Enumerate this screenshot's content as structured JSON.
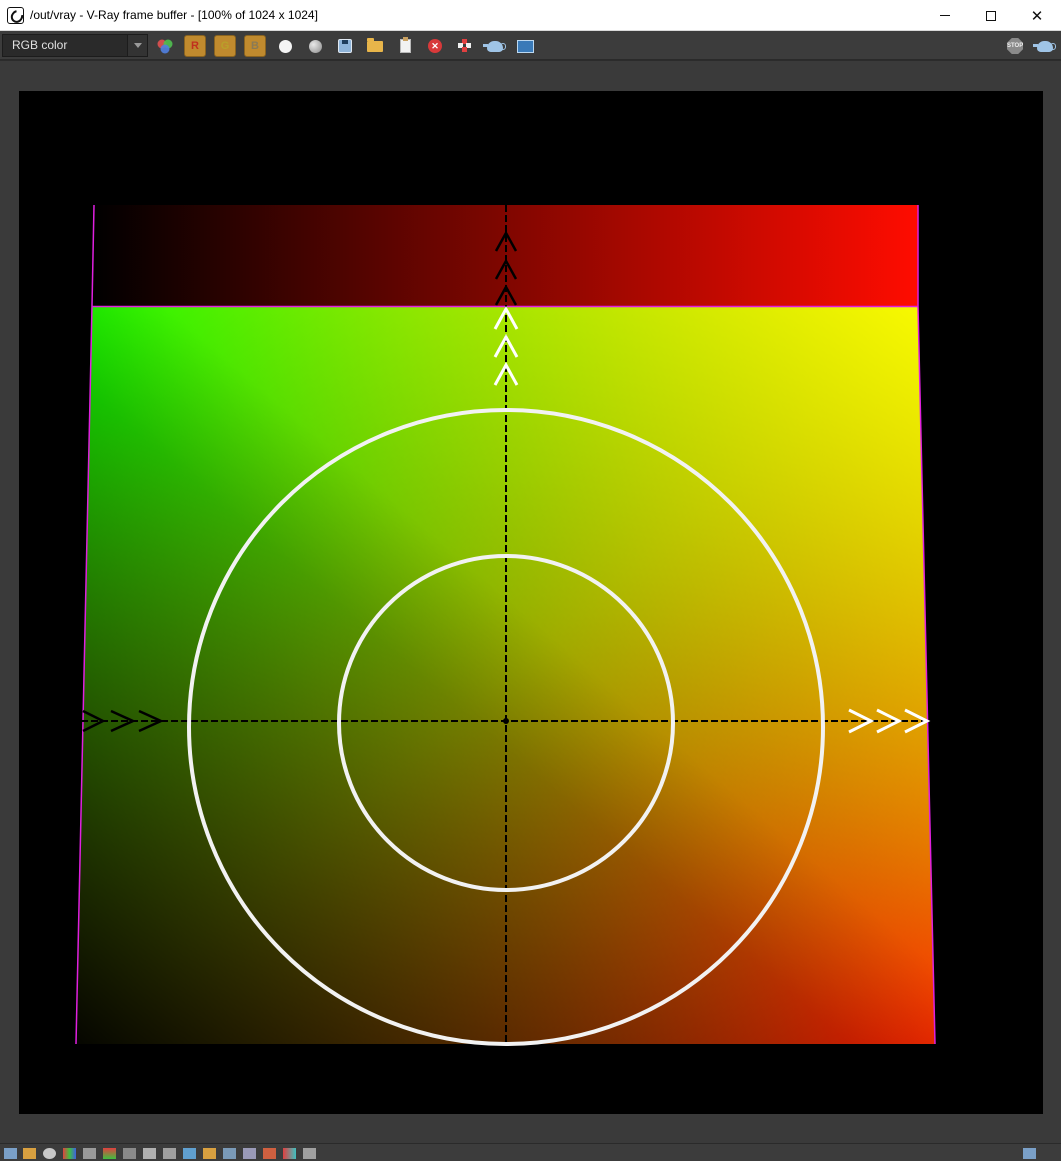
{
  "window": {
    "title": "/out/vray - V-Ray frame buffer - [100% of 1024 x 1024]",
    "minimize_label": "",
    "maximize_label": "",
    "close_label": "✕"
  },
  "toolbar": {
    "channel_select": {
      "value": "RGB color"
    },
    "buttons": [
      {
        "name": "channel-mix-icon"
      },
      {
        "name": "red-channel-button",
        "label": "R"
      },
      {
        "name": "green-channel-button",
        "label": "G"
      },
      {
        "name": "blue-channel-button",
        "label": "B"
      },
      {
        "name": "white-dot-icon"
      },
      {
        "name": "grey-sphere-icon"
      },
      {
        "name": "save-icon"
      },
      {
        "name": "open-folder-icon"
      },
      {
        "name": "clipboard-icon"
      },
      {
        "name": "clear-icon"
      },
      {
        "name": "region-render-icon"
      },
      {
        "name": "render-teapot-icon"
      },
      {
        "name": "film-icon"
      }
    ],
    "stop_label": "STOP",
    "clear_glyph": "✕"
  },
  "colors": {
    "red": "#ff1a00",
    "green": "#00ff00",
    "yellow": "#ffff00",
    "magenta_border": "#e020e0",
    "circle": "#f2f2f2",
    "axis": "#000000"
  }
}
